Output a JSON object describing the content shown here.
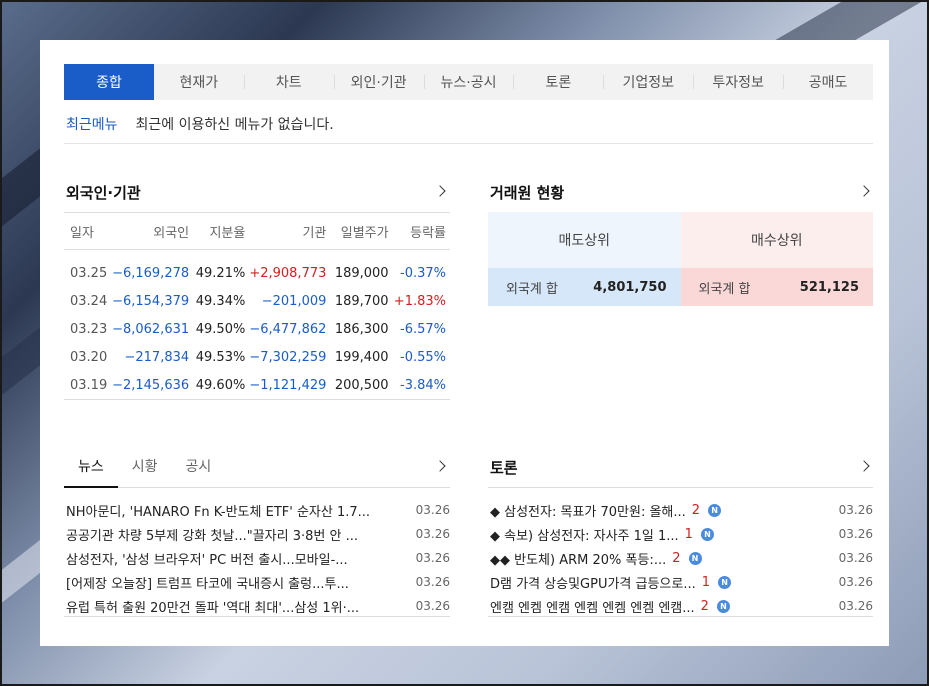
{
  "tabs": [
    "종합",
    "현재가",
    "차트",
    "외인·기관",
    "뉴스·공시",
    "토론",
    "기업정보",
    "투자정보",
    "공매도"
  ],
  "recent": {
    "label": "최근메뉴",
    "message": "최근에 이용하신 메뉴가 없습니다."
  },
  "foreign": {
    "title": "외국인·기관",
    "headers": [
      "일자",
      "외국인",
      "지분율",
      "기관",
      "일별주가",
      "등락률"
    ],
    "rows": [
      [
        "03.25",
        "−6,169,278",
        "49.21%",
        "+2,908,773",
        "189,000",
        "-0.37%"
      ],
      [
        "03.24",
        "−6,154,379",
        "49.34%",
        "−201,009",
        "189,700",
        "+1.83%"
      ],
      [
        "03.23",
        "−8,062,631",
        "49.50%",
        "−6,477,862",
        "186,300",
        "-6.57%"
      ],
      [
        "03.20",
        "−217,834",
        "49.53%",
        "−7,302,259",
        "199,400",
        "-0.55%"
      ],
      [
        "03.19",
        "−2,145,636",
        "49.60%",
        "−1,121,429",
        "200,500",
        "-3.84%"
      ]
    ]
  },
  "broker": {
    "title": "거래원 현황",
    "sell_header": "매도상위",
    "buy_header": "매수상위",
    "sell_label": "외국계 합",
    "sell_value": "4,801,750",
    "buy_label": "외국계 합",
    "buy_value": "521,125"
  },
  "news": {
    "tabs": [
      "뉴스",
      "시황",
      "공시"
    ],
    "items": [
      {
        "title": "NH아문디, 'HANARO Fn K-반도체 ETF' 순자산 1.7...",
        "date": "03.26"
      },
      {
        "title": "공공기관 차량 5부제 강화 첫날...\"끌자리 3·8번 안 ...",
        "date": "03.26"
      },
      {
        "title": "삼성전자, '삼성 브라우저' PC 버전 출시...모바일-...",
        "date": "03.26"
      },
      {
        "title": "[어제장 오늘장] 트럼프 타코에 국내증시 출렁...투...",
        "date": "03.26"
      },
      {
        "title": "유럽 특허 출원 20만건 돌파 '역대 최대'...삼성 1위·...",
        "date": "03.26"
      }
    ]
  },
  "debate": {
    "title": "토론",
    "items": [
      {
        "title": "◆ 삼성전자: 목표가 70만원: 올해...",
        "count": "2",
        "date": "03.26"
      },
      {
        "title": "◆ 속보) 삼성전자: 자사주 1일 1...",
        "count": "1",
        "date": "03.26"
      },
      {
        "title": "◆◆ 반도체) ARM 20% 폭등:...",
        "count": "2",
        "date": "03.26"
      },
      {
        "title": "D램 가격 상승및GPU가격 급등으로...",
        "count": "1",
        "date": "03.26"
      },
      {
        "title": "엔캠 엔켐 엔캠 엔켐 엔켐 엔켐 엔캠...",
        "count": "2",
        "date": "03.26"
      }
    ],
    "badge": "N"
  },
  "colors": {
    "accent": "#1a5cc8",
    "negative": "#1a5cc8",
    "positive": "#d12020"
  },
  "icons": {
    "more": "chevron-right-icon",
    "new": "new-badge-icon"
  }
}
